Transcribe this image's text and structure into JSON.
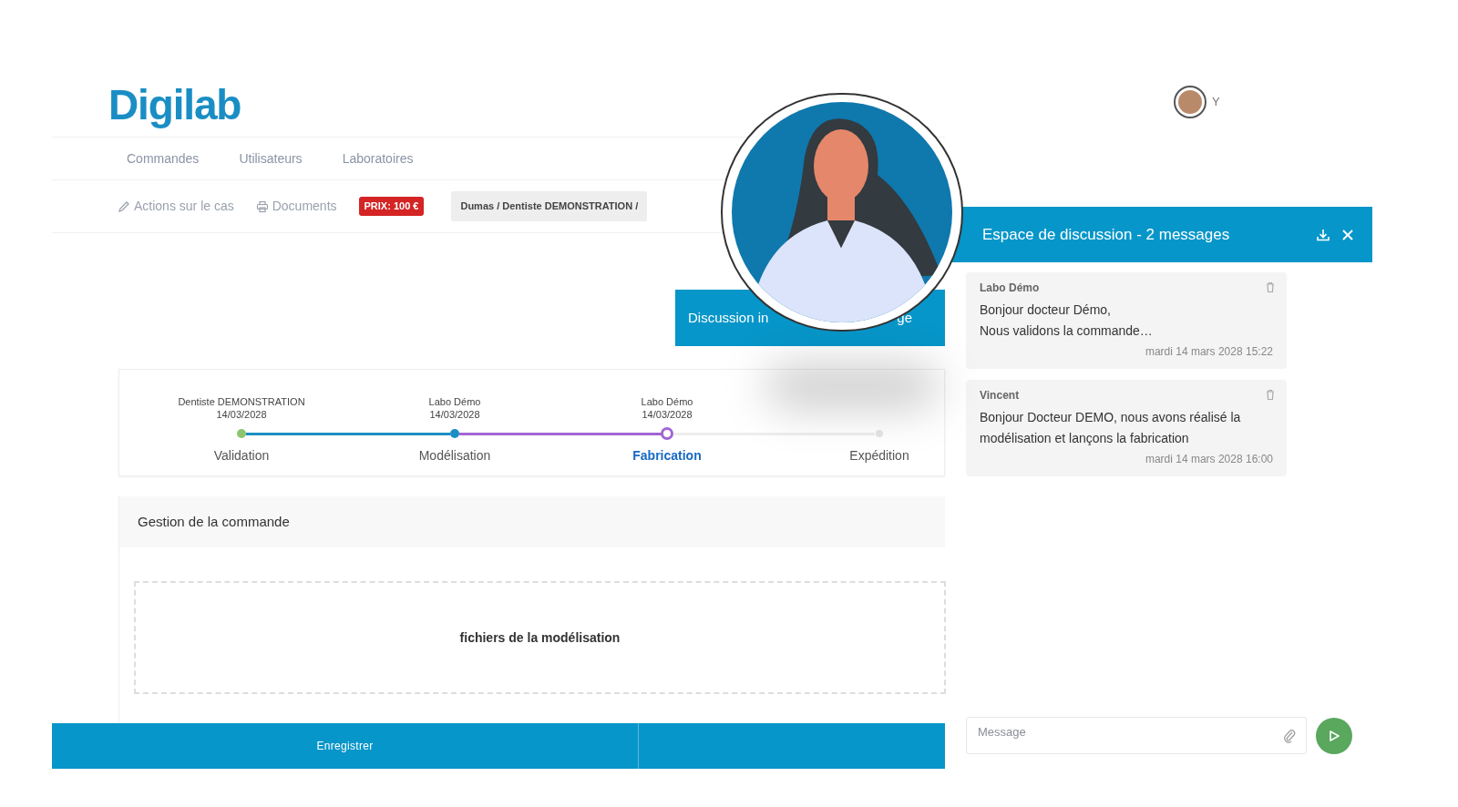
{
  "logo": "Digilab",
  "user": {
    "initial": "Y"
  },
  "nav": [
    {
      "label": "Commandes"
    },
    {
      "label": "Utilisateurs"
    },
    {
      "label": "Laboratoires"
    }
  ],
  "toolbar": {
    "actions": "Actions sur le cas",
    "documents": "Documents",
    "price": "PRIX: 100 €",
    "breadcrumb": "Dumas / Dentiste DEMONSTRATION /"
  },
  "discussion_button": {
    "label_start": "Discussion in",
    "label_end": "ge"
  },
  "steps": [
    {
      "actor": "Dentiste DEMONSTRATION",
      "date": "14/03/2028",
      "label": "Validation",
      "selected": false,
      "kind": "done",
      "color": "#8cc56e"
    },
    {
      "actor": "Labo Démo",
      "date": "14/03/2028",
      "label": "Modélisation",
      "selected": false,
      "kind": "done",
      "color": "#1b8fc4"
    },
    {
      "actor": "Labo Démo",
      "date": "14/03/2028",
      "label": "Fabrication",
      "selected": true,
      "kind": "current",
      "color": "#a066d3"
    },
    {
      "label": "Expédition",
      "selected": false,
      "kind": "pending",
      "color": "#e5e5e5"
    }
  ],
  "management": {
    "title": "Gestion de la commande",
    "dropzone": "fichiers de la modélisation"
  },
  "footer": {
    "save": "Enregistrer"
  },
  "chat": {
    "title": "Espace de discussion - 2 messages",
    "messages": [
      {
        "author": "Labo Démo",
        "lines": [
          "Bonjour docteur Démo,",
          "Nous validons la commande…"
        ],
        "time": "mardi 14 mars 2028 15:22"
      },
      {
        "author": "Vincent",
        "lines": [
          "Bonjour Docteur DEMO, nous avons réalisé la modélisation et lançons la fabrication"
        ],
        "time": "mardi 14 mars 2028 16:00"
      }
    ],
    "input": {
      "placeholder": "Message"
    }
  }
}
